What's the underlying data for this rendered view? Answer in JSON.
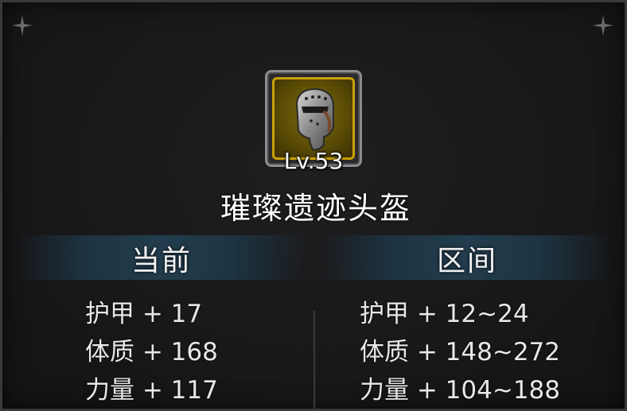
{
  "item": {
    "icon": "helmet-icon",
    "level": "Lv.53",
    "name": "璀璨遗迹头盔"
  },
  "headers": {
    "current": "当前",
    "range": "区间"
  },
  "current_stats": [
    {
      "label": "护甲 + 17"
    },
    {
      "label": "体质 + 168"
    },
    {
      "label": "力量 + 117"
    }
  ],
  "range_stats": [
    {
      "label": "护甲 + 12~24"
    },
    {
      "label": "体质 + 148~272"
    },
    {
      "label": "力量 + 104~188"
    }
  ],
  "colors": {
    "rarity_frame": "#c9a000",
    "header_band": "#233d4e",
    "text": "#ffffff"
  }
}
